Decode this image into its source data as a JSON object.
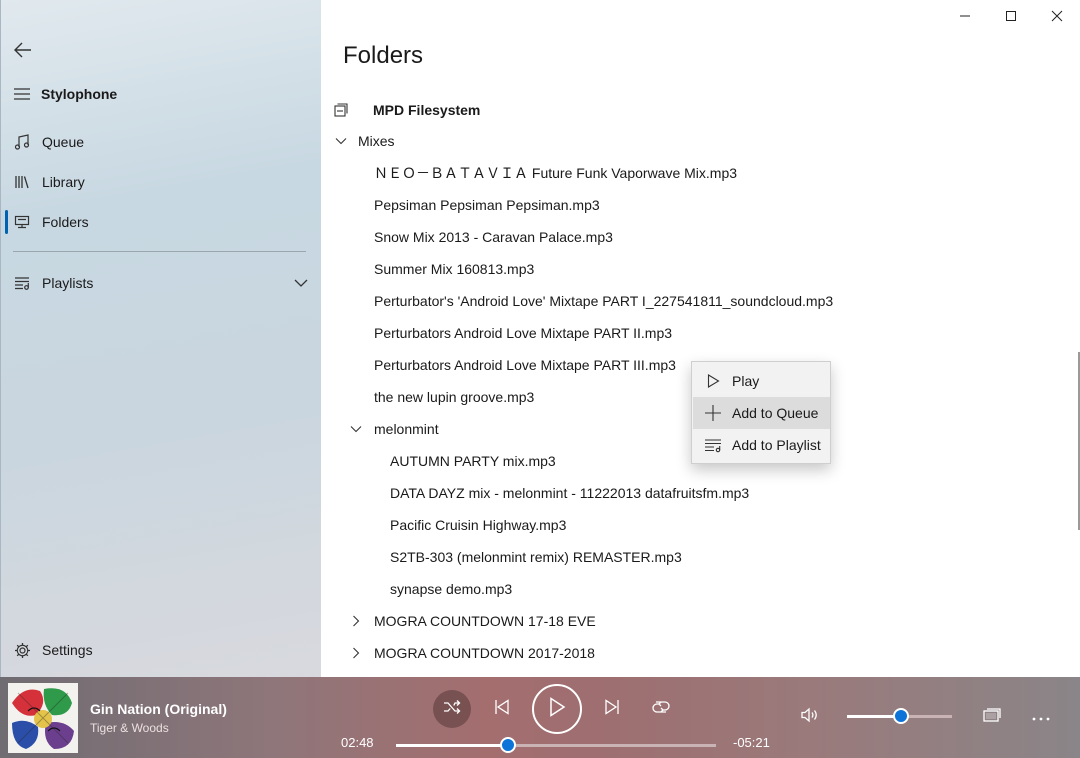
{
  "sidebar": {
    "app_title": "Stylophone",
    "items": [
      {
        "label": "Queue",
        "icon": "music-note-icon"
      },
      {
        "label": "Library",
        "icon": "library-icon"
      },
      {
        "label": "Folders",
        "icon": "folder-computer-icon"
      },
      {
        "label": "Playlists",
        "icon": "playlist-icon"
      }
    ],
    "selected": "Folders",
    "settings_label": "Settings",
    "accent_color": "#0063b1"
  },
  "main": {
    "title": "Folders",
    "root_label": "MPD Filesystem",
    "tree": [
      {
        "label": "Mixes",
        "kind": "folder",
        "expanded": true,
        "depth": 0
      },
      {
        "label": "ＮＥＯ－ＢＡＴＡＶＩＡ  Future Funk  Vaporwave Mix.mp3",
        "kind": "file",
        "depth": 1
      },
      {
        "label": "Pepsiman Pepsiman Pepsiman.mp3",
        "kind": "file",
        "depth": 1
      },
      {
        "label": "Snow Mix 2013 - Caravan Palace.mp3",
        "kind": "file",
        "depth": 1
      },
      {
        "label": "Summer Mix 160813.mp3",
        "kind": "file",
        "depth": 1
      },
      {
        "label": "Perturbator's 'Android Love' Mixtape PART I_227541811_soundcloud.mp3",
        "kind": "file",
        "depth": 1
      },
      {
        "label": "Perturbators Android Love Mixtape PART II.mp3",
        "kind": "file",
        "depth": 1
      },
      {
        "label": "Perturbators Android Love Mixtape PART III.mp3",
        "kind": "file",
        "depth": 1
      },
      {
        "label": "the new lupin groove.mp3",
        "kind": "file",
        "depth": 1
      },
      {
        "label": "melonmint",
        "kind": "folder",
        "expanded": true,
        "depth": 1
      },
      {
        "label": "AUTUMN PARTY mix.mp3",
        "kind": "file",
        "depth": 2
      },
      {
        "label": "DATA DAYZ mix - melonmint - 11222013 datafruitsfm.mp3",
        "kind": "file",
        "depth": 2
      },
      {
        "label": "Pacific Cruisin Highway.mp3",
        "kind": "file",
        "depth": 2
      },
      {
        "label": "S2TB-303 (melonmint remix) REMASTER.mp3",
        "kind": "file",
        "depth": 2
      },
      {
        "label": "synapse demo.mp3",
        "kind": "file",
        "depth": 2
      },
      {
        "label": "MOGRA COUNTDOWN 17-18 EVE",
        "kind": "folder",
        "expanded": false,
        "depth": 1
      },
      {
        "label": "MOGRA COUNTDOWN 2017-2018",
        "kind": "folder",
        "expanded": false,
        "depth": 1
      }
    ]
  },
  "context_menu": {
    "items": [
      {
        "label": "Play",
        "icon": "play-icon"
      },
      {
        "label": "Add to Queue",
        "icon": "plus-icon"
      },
      {
        "label": "Add to Playlist",
        "icon": "add-to-playlist-icon"
      }
    ],
    "hovered": "Add to Queue"
  },
  "player": {
    "title": "Gin Nation (Original)",
    "artist": "Tiger & Woods",
    "elapsed": "02:48",
    "remaining": "-05:21",
    "progress": 0.35,
    "volume": 0.51,
    "shuffle_active": true,
    "accent_color": "#0c74d8"
  }
}
